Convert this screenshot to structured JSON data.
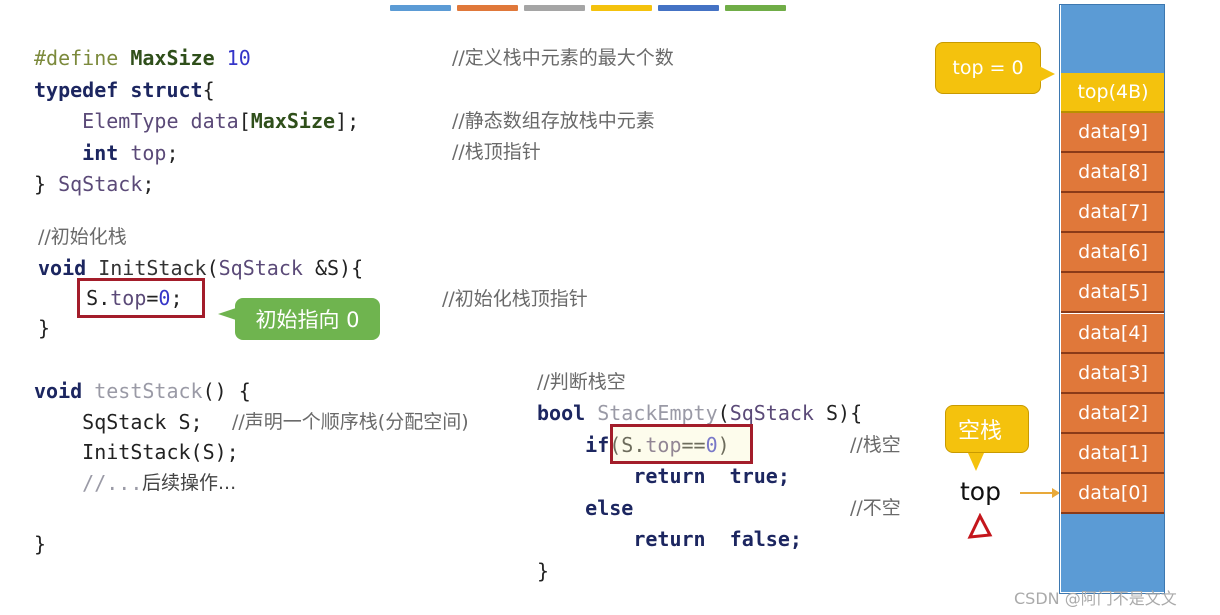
{
  "progress_strip_colors": [
    "#5b9bd5",
    "#e0783a",
    "#a5a5a5",
    "#f4c20d",
    "#4472c4",
    "#70ad47"
  ],
  "code_blocks": [
    {
      "id": "struct",
      "lines": [
        [
          {
            "t": "#define ",
            "c": "pp"
          },
          {
            "t": "MaxSize ",
            "c": "gn"
          },
          {
            "t": "10",
            "c": "num"
          }
        ],
        [
          {
            "t": "typedef struct",
            "c": "kw"
          },
          {
            "t": "{",
            "c": "pl"
          }
        ],
        [
          {
            "t": "    ElemType ",
            "c": "id"
          },
          {
            "t": "data",
            "c": "id"
          },
          {
            "t": "[",
            "c": "pl"
          },
          {
            "t": "MaxSize",
            "c": "gn"
          },
          {
            "t": "];",
            "c": "pl"
          }
        ],
        [
          {
            "t": "    int ",
            "c": "kw"
          },
          {
            "t": "top",
            "c": "id"
          },
          {
            "t": ";",
            "c": "pl"
          }
        ],
        [
          {
            "t": "} ",
            "c": "pl"
          },
          {
            "t": "SqStack",
            "c": "id"
          },
          {
            "t": ";",
            "c": "pl"
          }
        ]
      ]
    },
    {
      "id": "init",
      "lines": [
        [
          {
            "t": "void ",
            "c": "kw"
          },
          {
            "t": "InitStack",
            "c": "fn"
          },
          {
            "t": "(",
            "c": "pl"
          },
          {
            "t": "SqStack ",
            "c": "id"
          },
          {
            "t": "&S){",
            "c": "pl"
          }
        ],
        [
          {
            "t": "    S.",
            "c": "pl"
          },
          {
            "t": "top",
            "c": "id"
          },
          {
            "t": "=",
            "c": "pl"
          },
          {
            "t": "0",
            "c": "num"
          },
          {
            "t": ";",
            "c": "pl"
          }
        ],
        [
          {
            "t": "}",
            "c": "pl"
          }
        ]
      ]
    },
    {
      "id": "test",
      "lines": [
        [
          {
            "t": "void ",
            "c": "kw"
          },
          {
            "t": "testStack",
            "c": "gy"
          },
          {
            "t": "() {",
            "c": "pl"
          }
        ],
        [
          {
            "t": "    SqStack S;",
            "c": "pl"
          }
        ],
        [
          {
            "t": "    InitStack(S);",
            "c": "pl"
          }
        ],
        [
          {
            "t": "    //...",
            "c": "gy"
          }
        ],
        [
          {
            "t": "",
            "c": "pl"
          }
        ],
        [
          {
            "t": "}",
            "c": "pl"
          }
        ]
      ]
    },
    {
      "id": "empty",
      "lines": [
        [
          {
            "t": "bool ",
            "c": "kw"
          },
          {
            "t": "StackEmpty",
            "c": "gy"
          },
          {
            "t": "(",
            "c": "pl"
          },
          {
            "t": "SqStack ",
            "c": "id"
          },
          {
            "t": "S){",
            "c": "pl"
          }
        ],
        [
          {
            "t": "    if",
            "c": "kw"
          },
          {
            "t": "(S.",
            "c": "pl"
          },
          {
            "t": "top",
            "c": "id"
          },
          {
            "t": "==",
            "c": "pl"
          },
          {
            "t": "0",
            "c": "num"
          },
          {
            "t": ")",
            "c": "pl"
          }
        ],
        [
          {
            "t": "        return  true;",
            "c": "kw"
          }
        ],
        [
          {
            "t": "    else",
            "c": "kw"
          }
        ],
        [
          {
            "t": "        return  false;",
            "c": "kw"
          }
        ],
        [
          {
            "t": "}",
            "c": "pl"
          }
        ]
      ]
    }
  ],
  "comments": {
    "max": "//定义栈中元素的最大个数",
    "data": "//静态数组存放栈中元素",
    "top": "//栈顶指针",
    "init_title": "//初始化栈",
    "init_top": "//初始化栈顶指针",
    "declare": "//声明一个顺序栈(分配空间)",
    "followup": "后续操作...",
    "empty_title": "//判断栈空",
    "is_empty": "//栈空",
    "not_empty": "//不空"
  },
  "bubbles": {
    "init": "初始指向 0",
    "top_eq": "top = 0",
    "empty": "空栈"
  },
  "stack": {
    "top_cell": "top(4B)",
    "cells": [
      "data[9]",
      "data[8]",
      "data[7]",
      "data[6]",
      "data[5]",
      "data[4]",
      "data[3]",
      "data[2]",
      "data[1]",
      "data[0]"
    ]
  },
  "pointer_label": "top",
  "watermark": "CSDN @阿门不是文文"
}
